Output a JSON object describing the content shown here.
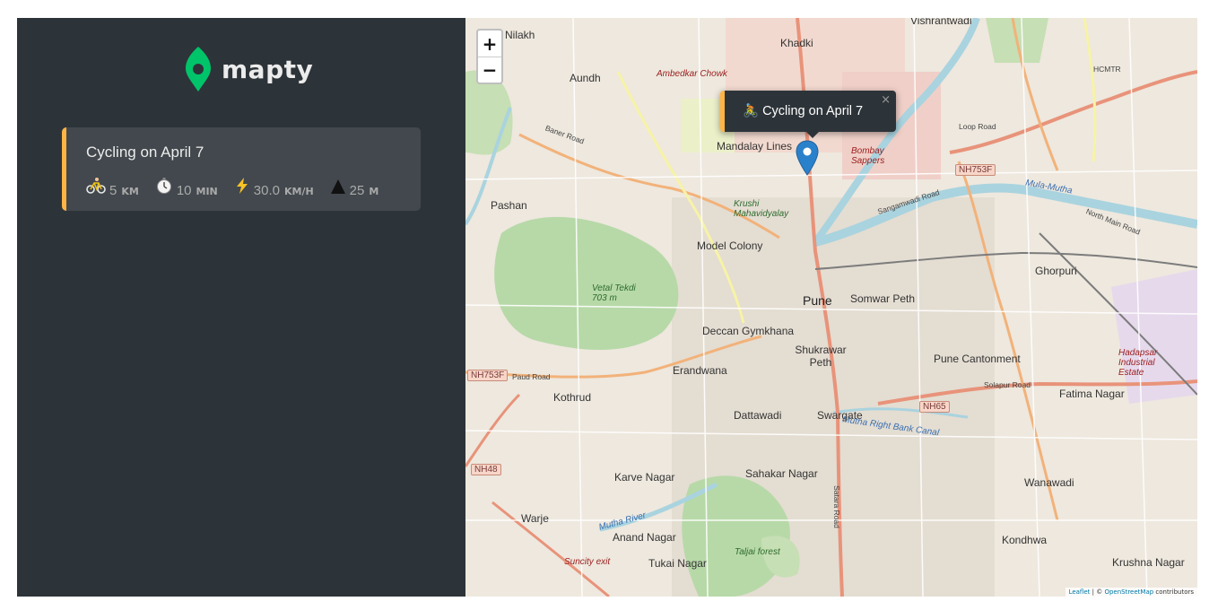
{
  "brand": {
    "name": "mapty",
    "icon": "map-pin-icon",
    "color": "#00c46a"
  },
  "workouts": [
    {
      "title": "Cycling on April 7",
      "type_icon": "bicycle-icon",
      "distance": {
        "value": "5",
        "unit": "KM"
      },
      "duration": {
        "value": "10",
        "unit": "MIN"
      },
      "speed": {
        "value": "30.0",
        "unit": "KM/H"
      },
      "elevation": {
        "value": "25",
        "unit": "M"
      }
    }
  ],
  "map": {
    "zoom_in": "+",
    "zoom_out": "−",
    "popup": {
      "text": "🚴 Cycling on April 7",
      "close": "×"
    },
    "attribution": {
      "leaflet": "Leaflet",
      "sep": " | © ",
      "osm": "OpenStreetMap",
      "tail": " contributors"
    },
    "labels": {
      "vishrantwadi": "Vishrantwadi",
      "nilakh": "Nilakh",
      "khadki": "Khadki",
      "aundh": "Aundh",
      "ambedkar": "Ambedkar Chowk",
      "mandalay": "Mandalay Lines",
      "bombay": "Bombay Sappers",
      "pashan": "Pashan",
      "krushi": "Krushi Mahavidyalay",
      "model_colony": "Model Colony",
      "vetal": "Vetal Tekdi 703 m",
      "pune": "Pune",
      "somwar": "Somwar Peth",
      "ghorpuri": "Ghorpuri",
      "deccan": "Deccan Gymkhana",
      "shukrawar": "Shukrawar Peth",
      "cantonment": "Pune Cantonment",
      "erandwana": "Erandwana",
      "hadapsar": "Hadapsar Industrial Estate",
      "kothrud": "Kothrud",
      "fatima": "Fatima Nagar",
      "dattawadi": "Dattawadi",
      "swargate": "Swargate",
      "sahakar": "Sahakar Nagar",
      "karve": "Karve Nagar",
      "wanawadi": "Wanawadi",
      "warje": "Warje",
      "anand": "Anand Nagar",
      "tukai": "Tukai Nagar",
      "kondhwa": "Kondhwa",
      "krushna": "Krushna Nagar",
      "suncity": "Suncity exit",
      "mutha_river": "Mutha River",
      "mula_mutha": "Mula-Mutha",
      "canal": "Mutha Right Bank Canal",
      "taljai": "Taljai forest",
      "hcmtr": "HCMTR",
      "nh753f_a": "NH753F",
      "nh753f_b": "NH753F",
      "nh65": "NH65",
      "nh48": "NH48",
      "solapur_road": "Solapur Road",
      "paud_road": "Paud Road",
      "baner_road": "Baner Road",
      "sangamwadi": "Sangamwadi Road",
      "north_main": "North Main Road",
      "satara": "Satara Road",
      "loop_road": "Loop Road"
    }
  }
}
